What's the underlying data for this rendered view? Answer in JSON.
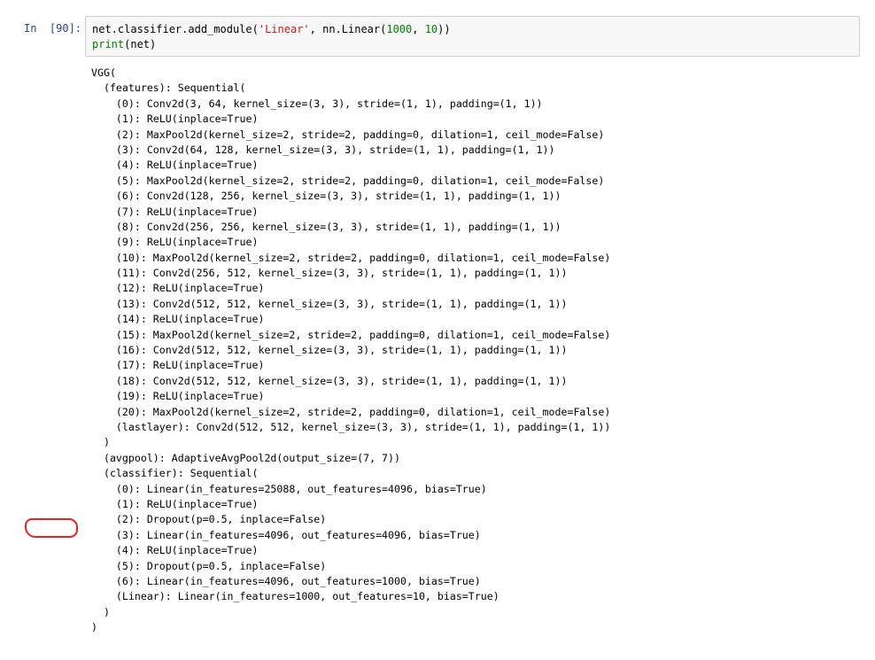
{
  "prompt": "In  [90]:",
  "input": {
    "line1": {
      "a": "net.classifier.add_module(",
      "b": "'Linear'",
      "c": ", nn.Linear(",
      "d": "1000",
      "e": ", ",
      "f": "10",
      "g": "))"
    },
    "line2": {
      "builtin": "print",
      "rest": "(net)"
    }
  },
  "output_lines": [
    "VGG(",
    "  (features): Sequential(",
    "    (0): Conv2d(3, 64, kernel_size=(3, 3), stride=(1, 1), padding=(1, 1))",
    "    (1): ReLU(inplace=True)",
    "    (2): MaxPool2d(kernel_size=2, stride=2, padding=0, dilation=1, ceil_mode=False)",
    "    (3): Conv2d(64, 128, kernel_size=(3, 3), stride=(1, 1), padding=(1, 1))",
    "    (4): ReLU(inplace=True)",
    "    (5): MaxPool2d(kernel_size=2, stride=2, padding=0, dilation=1, ceil_mode=False)",
    "    (6): Conv2d(128, 256, kernel_size=(3, 3), stride=(1, 1), padding=(1, 1))",
    "    (7): ReLU(inplace=True)",
    "    (8): Conv2d(256, 256, kernel_size=(3, 3), stride=(1, 1), padding=(1, 1))",
    "    (9): ReLU(inplace=True)",
    "    (10): MaxPool2d(kernel_size=2, stride=2, padding=0, dilation=1, ceil_mode=False)",
    "    (11): Conv2d(256, 512, kernel_size=(3, 3), stride=(1, 1), padding=(1, 1))",
    "    (12): ReLU(inplace=True)",
    "    (13): Conv2d(512, 512, kernel_size=(3, 3), stride=(1, 1), padding=(1, 1))",
    "    (14): ReLU(inplace=True)",
    "    (15): MaxPool2d(kernel_size=2, stride=2, padding=0, dilation=1, ceil_mode=False)",
    "    (16): Conv2d(512, 512, kernel_size=(3, 3), stride=(1, 1), padding=(1, 1))",
    "    (17): ReLU(inplace=True)",
    "    (18): Conv2d(512, 512, kernel_size=(3, 3), stride=(1, 1), padding=(1, 1))",
    "    (19): ReLU(inplace=True)",
    "    (20): MaxPool2d(kernel_size=2, stride=2, padding=0, dilation=1, ceil_mode=False)",
    "    (lastlayer): Conv2d(512, 512, kernel_size=(3, 3), stride=(1, 1), padding=(1, 1))",
    "  )",
    "  (avgpool): AdaptiveAvgPool2d(output_size=(7, 7))",
    "  (classifier): Sequential(",
    "    (0): Linear(in_features=25088, out_features=4096, bias=True)",
    "    (1): ReLU(inplace=True)",
    "    (2): Dropout(p=0.5, inplace=False)",
    "    (3): Linear(in_features=4096, out_features=4096, bias=True)",
    "    (4): ReLU(inplace=True)",
    "    (5): Dropout(p=0.5, inplace=False)",
    "    (6): Linear(in_features=4096, out_features=1000, bias=True)",
    "    (Linear): Linear(in_features=1000, out_features=10, bias=True)",
    "  )",
    ")"
  ],
  "colors": {
    "prompt": "#303f9f",
    "string": "#ba2121",
    "number": "#008000",
    "builtin": "#008000",
    "highlight": "#e52421",
    "input_bg": "#f7f7f7",
    "input_border": "#cfcfcf"
  }
}
